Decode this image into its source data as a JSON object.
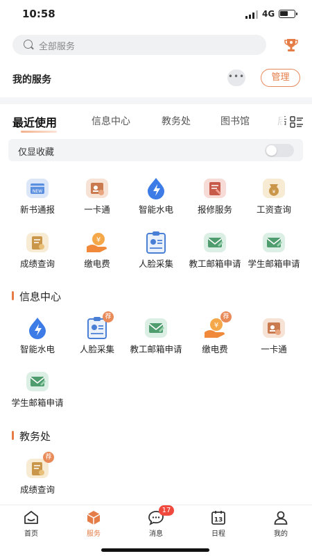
{
  "status": {
    "time": "10:58",
    "network": "4G"
  },
  "search": {
    "placeholder": "全部服务"
  },
  "my_services": {
    "title": "我的服务",
    "more_label": "•••",
    "manage_label": "管理"
  },
  "tabs": [
    {
      "label": "最近使用",
      "active": true
    },
    {
      "label": "信息中心",
      "active": false
    },
    {
      "label": "教务处",
      "active": false
    },
    {
      "label": "图书馆",
      "active": false
    },
    {
      "label": "后",
      "active": false
    }
  ],
  "favorites_only": {
    "label": "仅显收藏",
    "enabled": false
  },
  "recent_items": [
    {
      "label": "新书通报",
      "icon": "new-book-icon"
    },
    {
      "label": "一卡通",
      "icon": "campus-card-icon"
    },
    {
      "label": "智能水电",
      "icon": "smart-utility-icon"
    },
    {
      "label": "报修服务",
      "icon": "repair-service-icon"
    },
    {
      "label": "工资查询",
      "icon": "salary-query-icon"
    },
    {
      "label": "成绩查询",
      "icon": "grade-query-icon"
    },
    {
      "label": "缴电费",
      "icon": "pay-electricity-icon"
    },
    {
      "label": "人脸采集",
      "icon": "face-capture-icon"
    },
    {
      "label": "教工邮箱申请",
      "icon": "staff-mail-icon"
    },
    {
      "label": "学生邮箱申请",
      "icon": "student-mail-icon"
    }
  ],
  "sections": [
    {
      "title": "信息中心",
      "items": [
        {
          "label": "智能水电",
          "icon": "smart-utility-icon",
          "recommended": false
        },
        {
          "label": "人脸采集",
          "icon": "face-capture-icon",
          "recommended": true
        },
        {
          "label": "教工邮箱申请",
          "icon": "staff-mail-icon",
          "recommended": false
        },
        {
          "label": "缴电费",
          "icon": "pay-electricity-icon",
          "recommended": true
        },
        {
          "label": "一卡通",
          "icon": "campus-card-icon",
          "recommended": false
        },
        {
          "label": "学生邮箱申请",
          "icon": "student-mail-icon",
          "recommended": false
        }
      ]
    },
    {
      "title": "教务处",
      "items": [
        {
          "label": "成绩查询",
          "icon": "grade-query-icon",
          "recommended": true
        }
      ]
    }
  ],
  "recommend_badge": "荐",
  "bottom_nav": [
    {
      "label": "首页",
      "icon": "home-icon",
      "active": false
    },
    {
      "label": "服务",
      "icon": "service-cube-icon",
      "active": true
    },
    {
      "label": "消息",
      "icon": "message-icon",
      "active": false,
      "badge": "17"
    },
    {
      "label": "日程",
      "icon": "calendar-icon",
      "active": false,
      "calendar_day": "13"
    },
    {
      "label": "我的",
      "icon": "profile-icon",
      "active": false
    }
  ],
  "colors": {
    "accent": "#e57d48",
    "badge_red": "#f04a3e",
    "blue_icon": "#3d7be6"
  }
}
